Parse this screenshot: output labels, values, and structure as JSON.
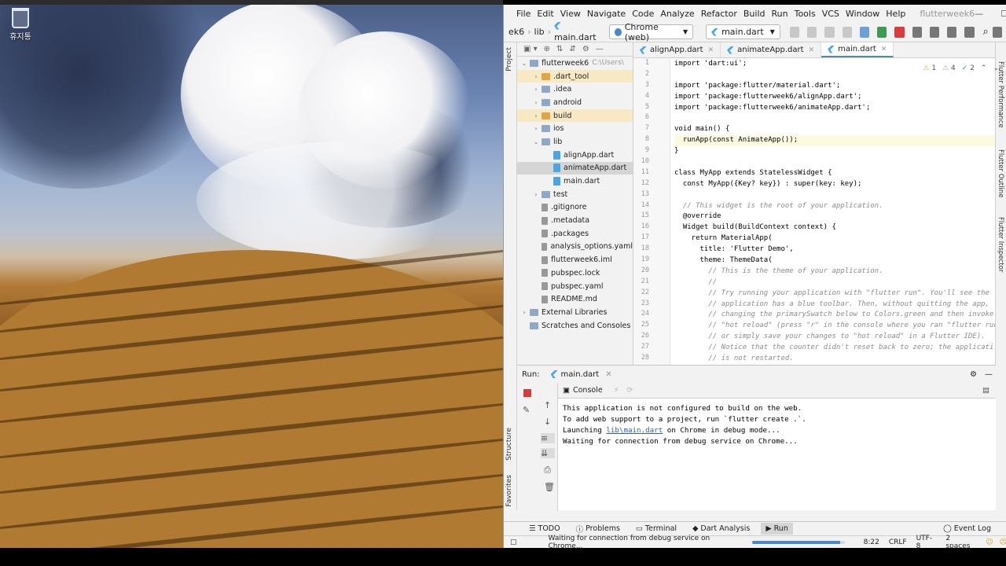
{
  "desktop": {
    "recycle_bin_label": "휴지통"
  },
  "menu": {
    "items": [
      "File",
      "Edit",
      "View",
      "Navigate",
      "Code",
      "Analyze",
      "Refactor",
      "Build",
      "Run",
      "Tools",
      "VCS",
      "Window",
      "Help"
    ],
    "project_name": "flutterweek6"
  },
  "toolbar": {
    "breadcrumb": [
      "ek6",
      "lib",
      "main.dart"
    ],
    "device": "Chrome (web)",
    "run_config": "main.dart"
  },
  "side_tabs": {
    "project": "Project",
    "structure": "Structure",
    "favorites": "Favorites"
  },
  "right_tabs": {
    "performance": "Flutter Performance",
    "outline": "Flutter Outline",
    "inspector": "Flutter Inspector"
  },
  "project_tree": [
    {
      "label": "flutterweek6",
      "hint": "C:\\Users\\",
      "depth": 0,
      "type": "folder",
      "expanded": true
    },
    {
      "label": ".dart_tool",
      "depth": 1,
      "type": "folder-orange",
      "expanded": false
    },
    {
      "label": ".idea",
      "depth": 1,
      "type": "folder",
      "expanded": false
    },
    {
      "label": "android",
      "depth": 1,
      "type": "folder",
      "expanded": false
    },
    {
      "label": "build",
      "depth": 1,
      "type": "folder-orange",
      "expanded": false
    },
    {
      "label": "ios",
      "depth": 1,
      "type": "folder",
      "expanded": false
    },
    {
      "label": "lib",
      "depth": 1,
      "type": "folder",
      "expanded": true
    },
    {
      "label": "alignApp.dart",
      "depth": 2,
      "type": "dart"
    },
    {
      "label": "animateApp.dart",
      "depth": 2,
      "type": "dart",
      "selected": true
    },
    {
      "label": "main.dart",
      "depth": 2,
      "type": "dart"
    },
    {
      "label": "test",
      "depth": 1,
      "type": "folder",
      "expanded": false
    },
    {
      "label": ".gitignore",
      "depth": 1,
      "type": "file"
    },
    {
      "label": ".metadata",
      "depth": 1,
      "type": "file"
    },
    {
      "label": ".packages",
      "depth": 1,
      "type": "file"
    },
    {
      "label": "analysis_options.yaml",
      "depth": 1,
      "type": "file"
    },
    {
      "label": "flutterweek6.iml",
      "depth": 1,
      "type": "file"
    },
    {
      "label": "pubspec.lock",
      "depth": 1,
      "type": "file"
    },
    {
      "label": "pubspec.yaml",
      "depth": 1,
      "type": "file"
    },
    {
      "label": "README.md",
      "depth": 1,
      "type": "file"
    },
    {
      "label": "External Libraries",
      "depth": 0,
      "type": "lib",
      "expanded": false
    },
    {
      "label": "Scratches and Consoles",
      "depth": 0,
      "type": "lib"
    }
  ],
  "editor": {
    "tabs": [
      "alignApp.dart",
      "animateApp.dart",
      "main.dart"
    ],
    "active_tab": "main.dart",
    "inspections": {
      "warnings": "1",
      "weak_warnings": "4",
      "ok": "2"
    },
    "lines": [
      {
        "n": "1",
        "text": "import 'dart:ui';"
      },
      {
        "n": "2",
        "text": ""
      },
      {
        "n": "3",
        "text": "import 'package:flutter/material.dart';"
      },
      {
        "n": "4",
        "text": "import 'package:flutterweek6/alignApp.dart';"
      },
      {
        "n": "5",
        "text": "import 'package:flutterweek6/animateApp.dart';"
      },
      {
        "n": "6",
        "text": ""
      },
      {
        "n": "7",
        "text": "void main() {"
      },
      {
        "n": "8",
        "text": "  runApp(const AnimateApp());"
      },
      {
        "n": "9",
        "text": "}"
      },
      {
        "n": "10",
        "text": ""
      },
      {
        "n": "11",
        "text": "class MyApp extends StatelessWidget {"
      },
      {
        "n": "12",
        "text": "  const MyApp({Key? key}) : super(key: key);"
      },
      {
        "n": "13",
        "text": ""
      },
      {
        "n": "14",
        "text": "  // This widget is the root of your application."
      },
      {
        "n": "15",
        "text": "  @override"
      },
      {
        "n": "16",
        "text": "  Widget build(BuildContext context) {"
      },
      {
        "n": "17",
        "text": "    return MaterialApp("
      },
      {
        "n": "18",
        "text": "      title: 'Flutter Demo',"
      },
      {
        "n": "19",
        "text": "      theme: ThemeData("
      },
      {
        "n": "20",
        "text": "        // This is the theme of your application."
      },
      {
        "n": "21",
        "text": "        //"
      },
      {
        "n": "22",
        "text": "        // Try running your application with \"flutter run\". You'll see the"
      },
      {
        "n": "23",
        "text": "        // application has a blue toolbar. Then, without quitting the app,"
      },
      {
        "n": "24",
        "text": "        // changing the primarySwatch below to Colors.green and then invoke"
      },
      {
        "n": "25",
        "text": "        // \"hot reload\" (press \"r\" in the console where you ran \"flutter run"
      },
      {
        "n": "26",
        "text": "        // or simply save your changes to \"hot reload\" in a Flutter IDE)."
      },
      {
        "n": "27",
        "text": "        // Notice that the counter didn't reset back to zero; the applicati"
      },
      {
        "n": "28",
        "text": "        // is not restarted."
      }
    ]
  },
  "run": {
    "label": "Run:",
    "config": "main.dart",
    "console_tab": "Console",
    "output": [
      "This application is not configured to build on the web.",
      "To add web support to a project, run `flutter create .`.",
      "Launching ",
      "Waiting for connection from debug service on Chrome..."
    ],
    "link": "lib\\main.dart",
    "link_suffix": " on Chrome in debug mode..."
  },
  "bottom_tabs": [
    "TODO",
    "Problems",
    "Terminal",
    "Dart Analysis",
    "Run"
  ],
  "event_log": "Event Log",
  "status": {
    "message": "Waiting for connection from debug service on Chrome...",
    "progress": 0.95,
    "position": "8:22",
    "line_sep": "CRLF",
    "encoding": "UTF-8",
    "indent": "2 spaces"
  }
}
